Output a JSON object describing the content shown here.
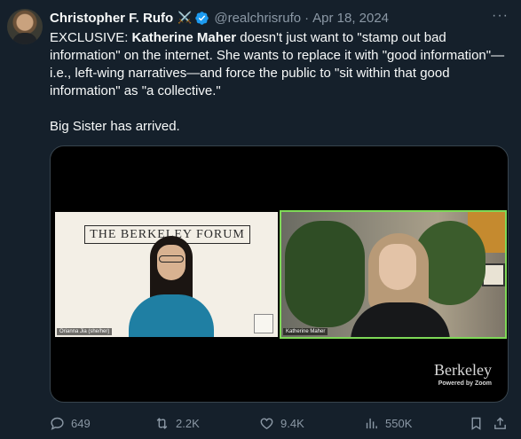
{
  "author": {
    "name": "Christopher F. Rufo",
    "emoji": "⚔️",
    "handle": "@realchrisrufo",
    "separator": "·",
    "date": "Apr 18, 2024"
  },
  "more_label": "···",
  "tweet": {
    "line1_prefix": "EXCLUSIVE: ",
    "line1_bold": "Katherine Maher",
    "line1_rest": " doesn't just want to \"stamp out bad information\" on the internet. She wants to replace it with \"good information\"—i.e., left-wing narratives—and force the public to \"sit within that good information\" as \"a collective.\"",
    "line2": "Big Sister has arrived."
  },
  "video": {
    "left_banner": "THE BERKELEY FORUM",
    "left_label": "Orianna Jia (she/her)",
    "right_label": "Katherine Maher",
    "brand_word": "Berkeley",
    "brand_sub": "Powered by Zoom"
  },
  "actions": {
    "replies": "649",
    "reposts": "2.2K",
    "likes": "9.4K",
    "views": "550K"
  },
  "colors": {
    "background": "#15202b",
    "text": "#f7f9f9",
    "muted": "#8b98a5",
    "verified": "#1d9bf0",
    "speaker_border": "#7ed957"
  }
}
